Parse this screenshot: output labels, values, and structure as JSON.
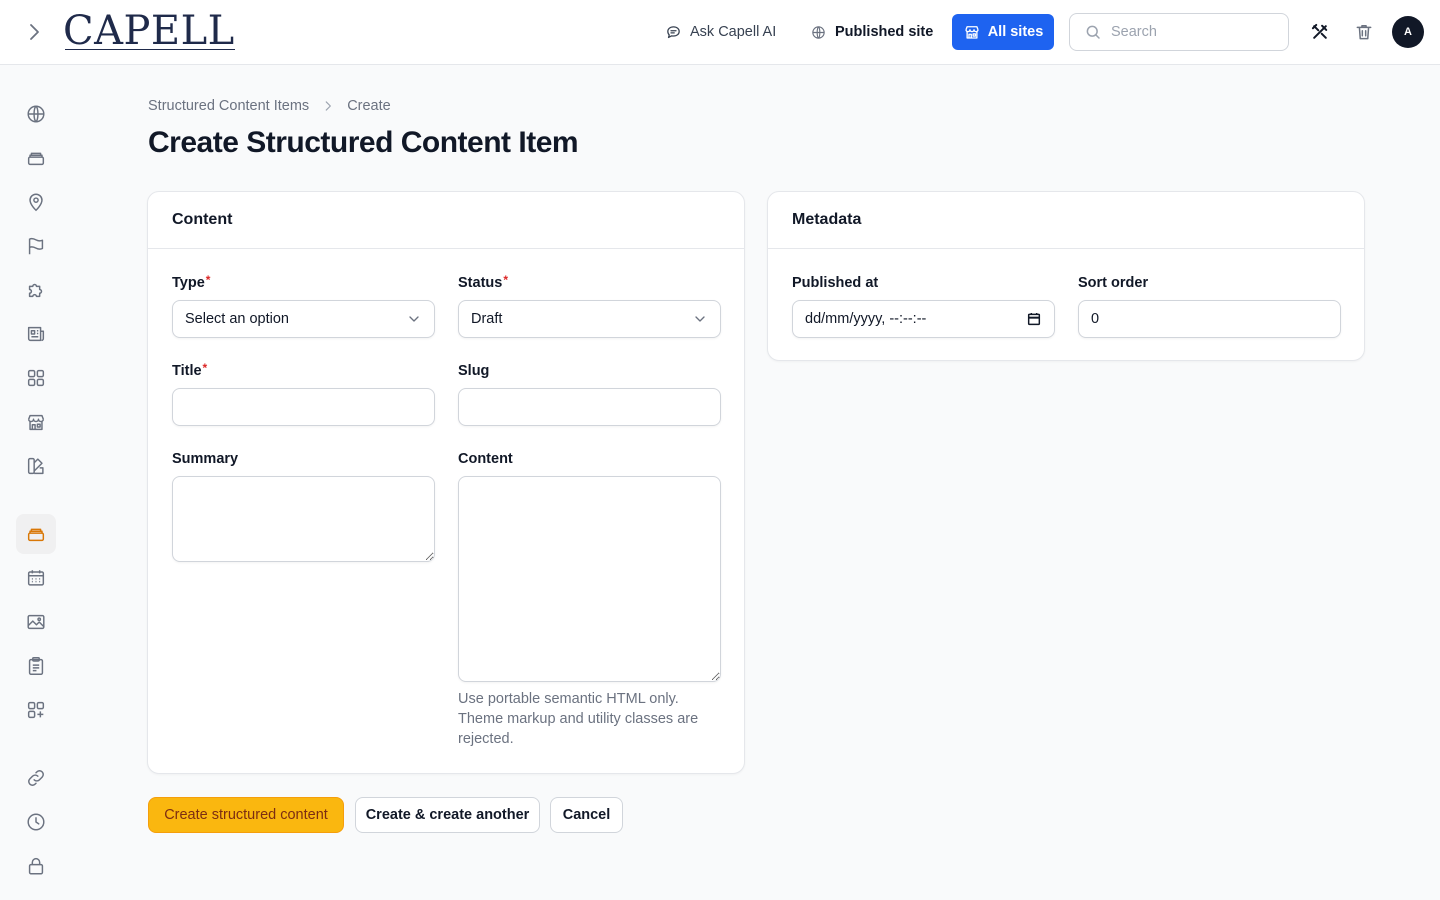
{
  "header": {
    "logo_text": "CAPELL",
    "ask_ai_label": "Ask Capell AI",
    "published_site_label": "Published site",
    "all_sites_label": "All sites",
    "search_placeholder": "Search",
    "avatar_initial": "A",
    "accent_color": "#1e63f0"
  },
  "sidebar": {
    "items": [
      {
        "icon": "globe-icon"
      },
      {
        "icon": "stack-icon"
      },
      {
        "icon": "map-pin-icon"
      },
      {
        "icon": "flag-icon"
      },
      {
        "icon": "puzzle-icon"
      },
      {
        "icon": "newspaper-icon"
      },
      {
        "icon": "grid-icon"
      },
      {
        "icon": "storefront-icon"
      },
      {
        "icon": "swatch-icon"
      },
      {
        "icon": "stack-icon",
        "active": true
      },
      {
        "icon": "calendar-icon"
      },
      {
        "icon": "image-icon"
      },
      {
        "icon": "clipboard-icon"
      },
      {
        "icon": "grid-plus-icon"
      },
      {
        "icon": "link-icon"
      },
      {
        "icon": "clock-icon"
      },
      {
        "icon": "lock-icon"
      }
    ]
  },
  "breadcrumb": {
    "parent": "Structured Content Items",
    "current": "Create"
  },
  "page": {
    "title": "Create Structured Content Item"
  },
  "content_card": {
    "heading": "Content",
    "type_label": "Type",
    "type_value": "Select an option",
    "status_label": "Status",
    "status_value": "Draft",
    "title_label": "Title",
    "title_value": "",
    "slug_label": "Slug",
    "slug_value": "",
    "summary_label": "Summary",
    "summary_value": "",
    "content_label": "Content",
    "content_value": "",
    "content_helper": "Use portable semantic HTML only. Theme markup and utility classes are rejected.",
    "required_marker": "*"
  },
  "metadata_card": {
    "heading": "Metadata",
    "published_at_label": "Published at",
    "published_at_value": "dd/mm/yyyy, --:--:--",
    "sort_order_label": "Sort order",
    "sort_order_value": "0"
  },
  "actions": {
    "create_label": "Create structured content",
    "create_another_label": "Create & create another",
    "cancel_label": "Cancel",
    "primary_color": "#fab70f"
  }
}
